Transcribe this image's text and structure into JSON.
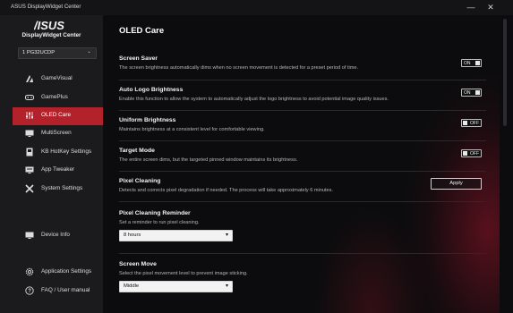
{
  "window": {
    "title": "ASUS DisplayWidget Center",
    "minimize": "—",
    "close": "✕"
  },
  "sidebar": {
    "brand_logo": "/ISUS",
    "brand_name": "DisplayWidget Center",
    "monitor_select": {
      "value": "1 PG32UCDP",
      "chevron": "⌄"
    },
    "items": [
      {
        "label": "GameVisual",
        "icon": "gamevisual-icon"
      },
      {
        "label": "GamePlus",
        "icon": "gamepad-icon"
      },
      {
        "label": "OLED Care",
        "icon": "sliders-icon",
        "active": true
      },
      {
        "label": "MultiScreen",
        "icon": "monitor-icon"
      },
      {
        "label": "KB HotKey Settings",
        "icon": "keyboard-icon"
      },
      {
        "label": "App Tweaker",
        "icon": "app-tweaker-icon"
      },
      {
        "label": "System Settings",
        "icon": "wrench-icon"
      },
      {
        "label": "Device Info",
        "icon": "display-info-icon"
      },
      {
        "label": "Application Settings",
        "icon": "gear-icon"
      },
      {
        "label": "FAQ / User manual",
        "icon": "help-icon"
      }
    ]
  },
  "main": {
    "title": "OLED Care",
    "settings": [
      {
        "title": "Screen Saver",
        "desc": "The screen brightness automatically dims when no screen movement is detected for a preset period of time.",
        "toggle": "ON"
      },
      {
        "title": "Auto Logo Brightness",
        "desc": "Enable this function to allow the system to automatically adjust the logo brightness to avoid potential image quality issues.",
        "toggle": "ON"
      },
      {
        "title": "Uniform Brightness",
        "desc": "Maintains brightness at a consistent level for comfortable viewing.",
        "toggle": "OFF"
      },
      {
        "title": "Target Mode",
        "desc": "The entire screen dims, but the targeted pinned window maintains its brightness.",
        "toggle": "OFF"
      },
      {
        "title": "Pixel Cleaning",
        "desc": "Detects and corrects pixel degradation if needed. The process will take approximately 6 minutes.",
        "button": "Apply"
      },
      {
        "title": "Pixel Cleaning Reminder",
        "desc": "Set a reminder to run pixel cleaning.",
        "dropdown": "8 hours"
      },
      {
        "title": "Screen Move",
        "desc": "Select the pixel movement level to prevent image sticking.",
        "dropdown": "Middle"
      }
    ]
  },
  "colors": {
    "accent": "#b3222b",
    "sidebar": "#1b1b1d",
    "background": "#0c0c0e"
  }
}
